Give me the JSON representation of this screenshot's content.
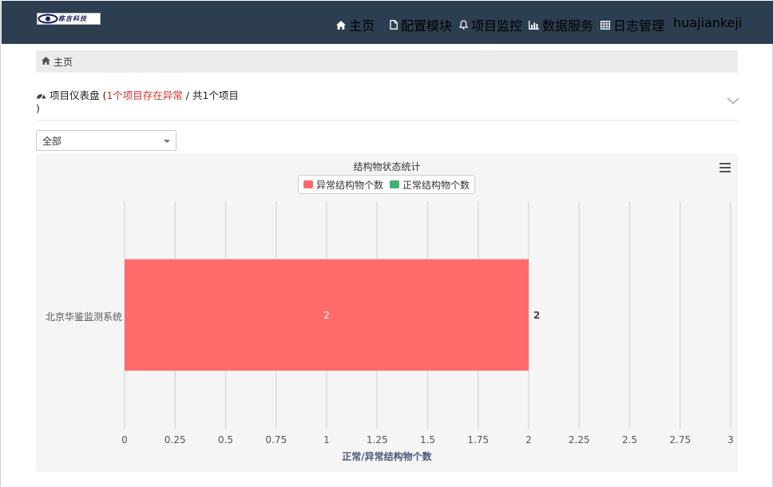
{
  "brand": {
    "logo_text": "栋吉科技"
  },
  "nav": {
    "items": [
      {
        "label": "主页",
        "icon": "home-icon"
      },
      {
        "label": "配置模块",
        "icon": "file-icon"
      },
      {
        "label": "项目监控",
        "icon": "bell-icon"
      },
      {
        "label": "数据服务",
        "icon": "bar-chart-icon"
      },
      {
        "label": "日志管理",
        "icon": "table-icon"
      }
    ],
    "user": "huajiankeji"
  },
  "breadcrumb": {
    "home": "主页"
  },
  "dashboard": {
    "title_prefix": "项目仪表盘 (",
    "warning": "1个项目存在异常",
    "title_suffix": " / 共1个项目 )"
  },
  "filter": {
    "selected": "全部"
  },
  "chart_data": {
    "type": "bar",
    "orientation": "horizontal",
    "title": "结构物状态统计",
    "categories": [
      "北京华鉴监测系统"
    ],
    "series": [
      {
        "name": "异常结构物个数",
        "values": [
          2
        ],
        "color": "#ff6a6a"
      },
      {
        "name": "正常结构物个数",
        "values": [
          0
        ],
        "color": "#3cb371"
      }
    ],
    "xlabel": "正常/异常结构物个数",
    "xlim": [
      0,
      3
    ],
    "xticks": [
      "0",
      "0.25",
      "0.5",
      "0.75",
      "1",
      "1.25",
      "1.5",
      "1.75",
      "2",
      "2.25",
      "2.5",
      "2.75",
      "3"
    ],
    "data_labels": [
      "2"
    ],
    "total_labels": [
      "2"
    ],
    "grid": true,
    "legend": "top-center"
  },
  "colors": {
    "navbar": "#2c3e50",
    "warning": "#d9302c",
    "abnormal": "#ff6a6a",
    "normal": "#3cb371"
  }
}
